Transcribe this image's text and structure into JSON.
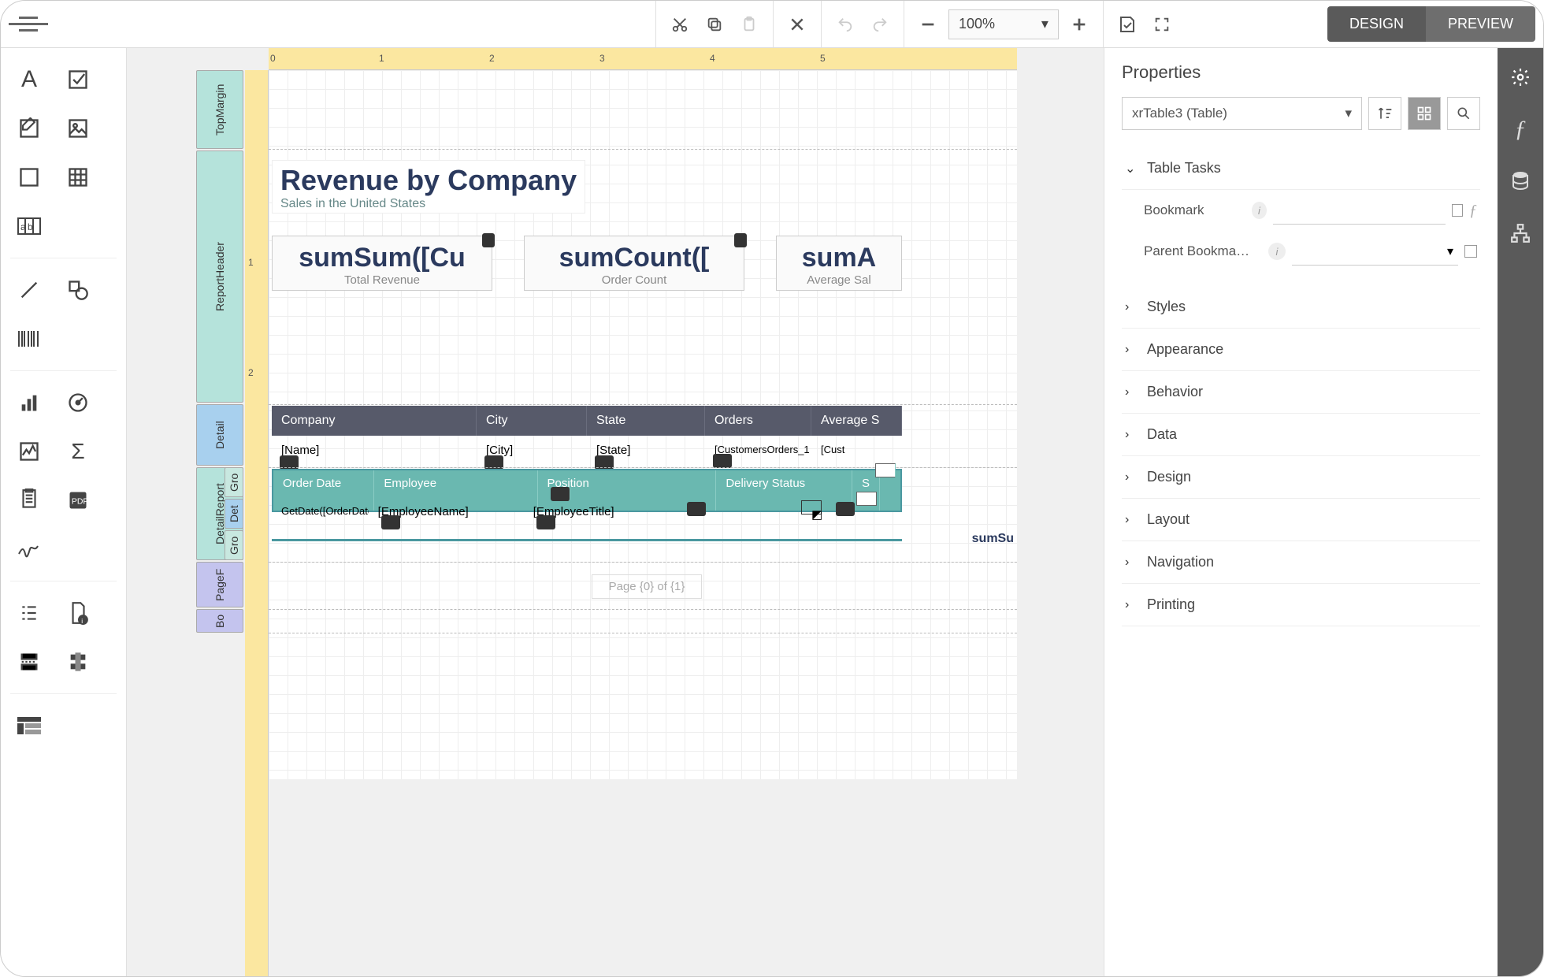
{
  "toolbar": {
    "zoom": "100%"
  },
  "modes": {
    "design": "DESIGN",
    "preview": "PREVIEW"
  },
  "report": {
    "title": "Revenue by Company",
    "subtitle": "Sales in the United States",
    "kpis": [
      {
        "expr": "sumSum([Cu",
        "label": "Total Revenue"
      },
      {
        "expr": "sumCount([",
        "label": "Order Count"
      },
      {
        "expr": "sumA",
        "label": "Average Sal"
      }
    ],
    "tableHeaders": [
      "Company",
      "City",
      "State",
      "Orders",
      "Average S"
    ],
    "tableRow": [
      "[Name]",
      "[City]",
      "[State]",
      "[CustomersOrders_1",
      "[Cust"
    ],
    "subHeaders": [
      "Order Date",
      "Employee",
      "Position",
      "Delivery Status",
      "S"
    ],
    "subRow": [
      "GetDate([OrderDate])",
      "[EmployeeName]",
      "[EmployeeTitle]",
      "",
      ""
    ],
    "sumRow": "sumSu",
    "pageInfo": "Page {0} of {1}",
    "bands": [
      "TopMargin",
      "ReportHeader",
      "Detail",
      "DetailReport",
      "PageF",
      "Bo"
    ],
    "miniBands": [
      "Gro",
      "Det",
      "Gro"
    ]
  },
  "ruler": {
    "h": [
      "0",
      "1",
      "2",
      "3",
      "4",
      "5"
    ],
    "v": [
      "1",
      "2"
    ]
  },
  "props": {
    "title": "Properties",
    "selected": "xrTable3 (Table)",
    "openSection": "Table Tasks",
    "fields": {
      "bookmark": "Bookmark",
      "parentBookmark": "Parent Bookma…"
    },
    "sections": [
      "Styles",
      "Appearance",
      "Behavior",
      "Data",
      "Design",
      "Layout",
      "Navigation",
      "Printing"
    ]
  }
}
